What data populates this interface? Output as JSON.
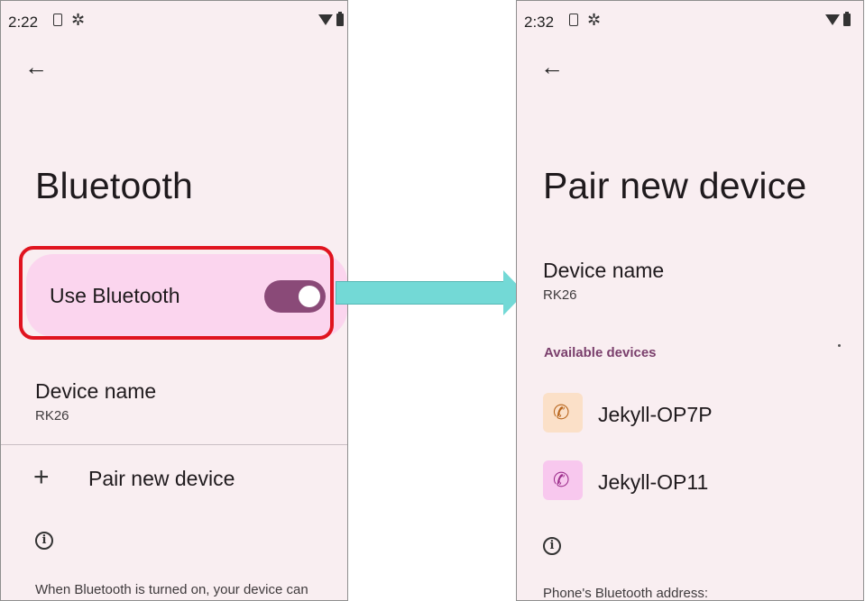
{
  "left_screen": {
    "status_time": "2:22",
    "title": "Bluetooth",
    "use_bluetooth_label": "Use Bluetooth",
    "use_bluetooth_on": true,
    "device_name_label": "Device name",
    "device_name_value": "RK26",
    "pair_new_label": "Pair new device",
    "footer_text": "When Bluetooth is turned on, your device can"
  },
  "right_screen": {
    "status_time": "2:32",
    "title": "Pair new device",
    "device_name_label": "Device name",
    "device_name_value": "RK26",
    "available_header": "Available devices",
    "devices": [
      {
        "name": "Jekyll-OP7P",
        "icon": "phone-icon",
        "icon_bg": "#fbe0c8",
        "icon_color": "#b8651c"
      },
      {
        "name": "Jekyll-OP11",
        "icon": "phone-icon",
        "icon_bg": "#f8c8ee",
        "icon_color": "#9d2f8c"
      }
    ],
    "footer_text": "Phone's Bluetooth address:"
  },
  "icons": {
    "back": "arrow-left-icon",
    "plus": "plus-icon",
    "info": "info-icon",
    "gear": "gear-icon",
    "sim": "sim-icon",
    "wifi": "wifi-icon",
    "battery": "battery-icon"
  },
  "colors": {
    "screen_bg": "#f9eef1",
    "toggle_track": "#8a4a78",
    "highlight_card": "#fbd5ee",
    "highlight_border": "#e0141f",
    "accent_header": "#7a3f6c",
    "connector_arrow": "#73d9d6"
  }
}
